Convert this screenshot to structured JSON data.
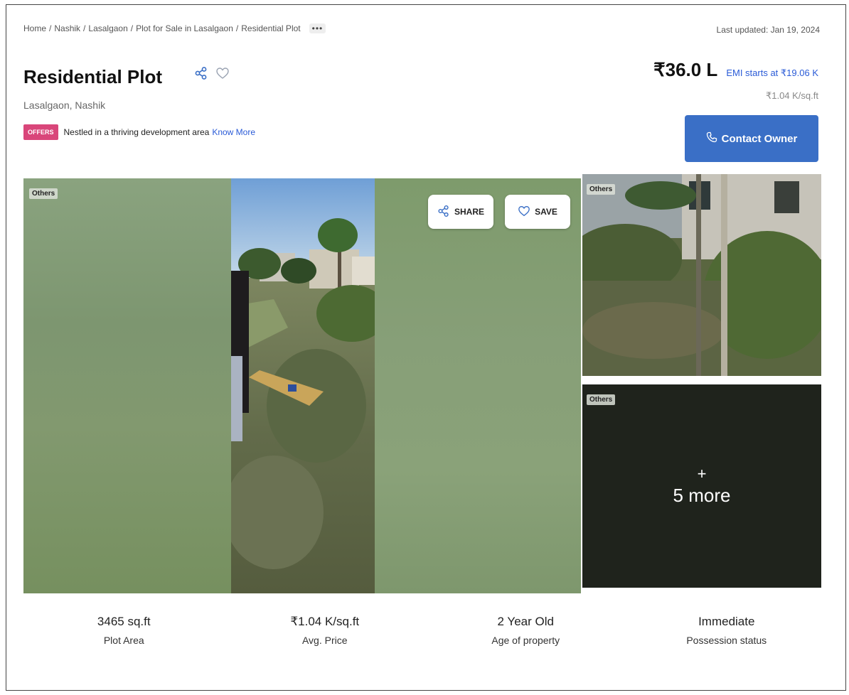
{
  "breadcrumb": [
    "Home",
    "Nashik",
    "Lasalgaon",
    "Plot for Sale in Lasalgaon",
    "Residential Plot"
  ],
  "more_dots": "•••",
  "last_updated": "Last updated: Jan 19, 2024",
  "title": "Residential Plot",
  "location": "Lasalgaon, Nashik",
  "offers": {
    "badge": "OFFERS",
    "text": "Nestled in a thriving development area",
    "link": "Know More"
  },
  "price": "₹36.0 L",
  "emi": "EMI starts at ₹19.06 K",
  "price_per_sqft": "₹1.04 K/sq.ft",
  "contact_label": "Contact Owner",
  "gallery": {
    "main_tag": "Others",
    "share_label": "SHARE",
    "save_label": "SAVE",
    "thumb1_tag": "Others",
    "thumb2_tag": "Others",
    "more_plus": "+",
    "more_label": "5 more"
  },
  "stats": [
    {
      "value": "3465 sq.ft",
      "label": "Plot Area"
    },
    {
      "value": "₹1.04 K/sq.ft",
      "label": "Avg. Price"
    },
    {
      "value": "2 Year Old",
      "label": "Age of property"
    },
    {
      "value": "Immediate",
      "label": "Possession status"
    }
  ],
  "colors": {
    "accent": "#3a6fc6",
    "offers_badge": "#d9467a",
    "link": "#2a5bd7"
  }
}
